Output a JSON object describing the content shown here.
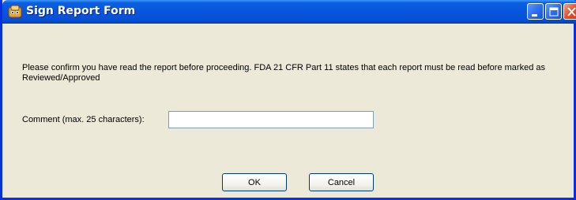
{
  "window": {
    "title": "Sign Report Form",
    "icon": "app-icon",
    "controls": [
      "minimize-icon",
      "maximize-icon",
      "close-icon"
    ]
  },
  "message": "Please confirm you have read the report before proceeding. FDA 21 CFR Part 11 states that each report must be read before marked as Reviewed/Approved",
  "comment": {
    "label": "Comment (max. 25 characters):",
    "value": "",
    "placeholder": ""
  },
  "buttons": {
    "ok": "OK",
    "cancel": "Cancel"
  },
  "colors": {
    "titlebar": "#0855dd",
    "window_bg": "#ece9d8",
    "close_button": "#e2542d",
    "input_border": "#7f9db9",
    "button_border": "#003c74"
  }
}
